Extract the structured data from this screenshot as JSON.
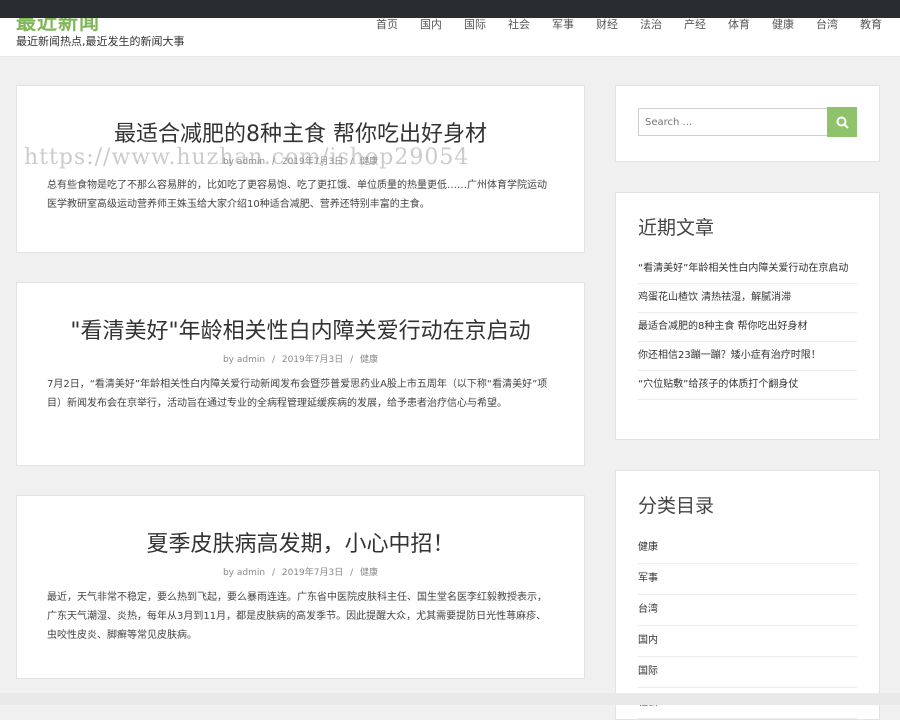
{
  "site": {
    "title": "最近新闻",
    "description": "最近新闻热点,最近发生的新闻大事"
  },
  "nav": [
    "首页",
    "国内",
    "国际",
    "社会",
    "军事",
    "财经",
    "法治",
    "产经",
    "体育",
    "健康",
    "台湾",
    "教育"
  ],
  "watermark": "https://www.huzhan.com/ishop29054",
  "posts": [
    {
      "title": "最适合减肥的8种主食 帮你吃出好身材",
      "meta": {
        "author": "by admin",
        "sep1": "/",
        "date": "2019年7月3日",
        "sep2": "/",
        "category": "健康"
      },
      "excerpt": "总有些食物是吃了不那么容易胖的，比如吃了更容易饱、吃了更扛饿、单位质量的热量更低……广州体育学院运动医学教研室高级运动营养师王姝玉给大家介绍10种适合减肥、营养还特别丰富的主食。"
    },
    {
      "title": "\"看清美好\"年龄相关性白内障关爱行动在京启动",
      "meta": {
        "author": "by admin",
        "sep1": "/",
        "date": "2019年7月3日",
        "sep2": "/",
        "category": "健康"
      },
      "excerpt": "7月2日，“看清美好”年龄相关性白内障关爱行动新闻发布会暨莎普爱思药业A股上市五周年（以下称“看清美好”项目）新闻发布会在京举行，活动旨在通过专业的全病程管理延缓疾病的发展，给予患者治疗信心与希望。"
    },
    {
      "title": "夏季皮肤病高发期，小心中招！",
      "meta": {
        "author": "by admin",
        "sep1": "/",
        "date": "2019年7月3日",
        "sep2": "/",
        "category": "健康"
      },
      "excerpt": "最近，天气非常不稳定，要么热到飞起，要么暴雨连连。广东省中医院皮肤科主任、国生堂名医李红毅教授表示，广东天气潮湿、炎热，每年从3月到11月，都是皮肤病的高发季节。因此提醒大众，尤其需要提防日光性荨麻疹、虫咬性皮炎、脚癣等常见皮肤病。"
    }
  ],
  "search": {
    "placeholder": "Search ..."
  },
  "recent": {
    "title": "近期文章",
    "items": [
      "“看清美好”年龄相关性白内障关爱行动在京启动",
      "鸡蛋花山楂饮 清热祛湿，解腻消滞",
      "最适合减肥的8种主食 帮你吃出好身材",
      "你还相信23蹦一蹦？矮小症有治疗时限！",
      "“穴位贴敷”给孩子的体质打个翻身仗"
    ]
  },
  "categories": {
    "title": "分类目录",
    "items": [
      "健康",
      "军事",
      "台湾",
      "国内",
      "国际",
      "社会"
    ]
  },
  "colors": {
    "accent": "#8ec26b",
    "topbar": "#2a2d30"
  }
}
